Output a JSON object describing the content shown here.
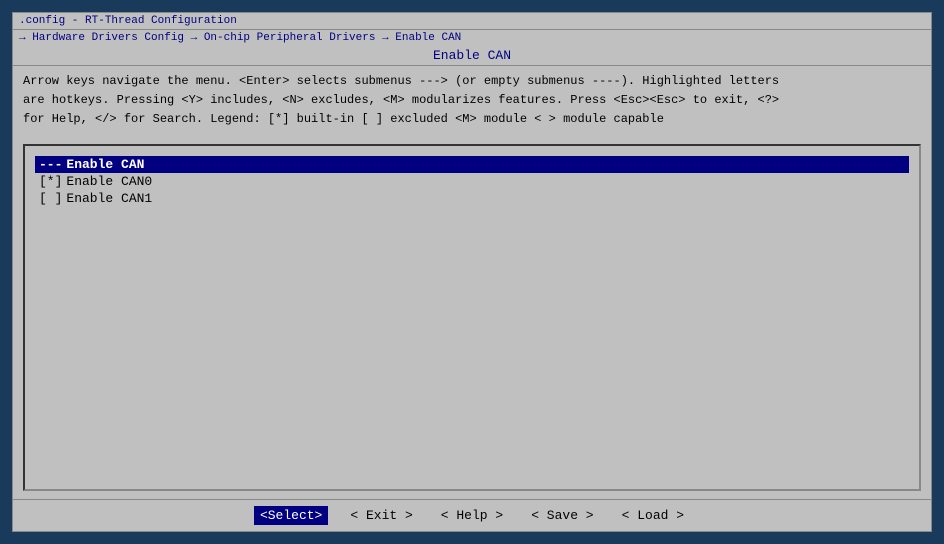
{
  "titlebar": {
    "text": ".config - RT-Thread Configuration"
  },
  "breadcrumb": {
    "text": "→ Hardware Drivers Config → On-chip Peripheral Drivers → Enable CAN"
  },
  "page_title": "Enable CAN",
  "help": {
    "line1": "Arrow keys navigate the menu.  <Enter> selects submenus ---> (or empty submenus ----).  Highlighted letters",
    "line2": "are hotkeys.  Pressing <Y> includes, <N> excludes, <M> modularizes features.  Press <Esc><Esc> to exit, <?>",
    "line3": "for Help, </> for Search.  Legend: [*] built-in  [ ] excluded  <M> module  < > module capable"
  },
  "menu": {
    "items": [
      {
        "id": "enable-can-parent",
        "prefix": "---",
        "label": "Enable CAN",
        "selected": true,
        "type": "parent"
      },
      {
        "id": "enable-can0",
        "prefix": "[*]",
        "label": "Enable CAN0",
        "selected": false,
        "type": "option"
      },
      {
        "id": "enable-can1",
        "prefix": "[ ]",
        "label": "Enable CAN1",
        "selected": false,
        "type": "option"
      }
    ]
  },
  "bottom_bar": {
    "select_label": "<Select>",
    "exit_label": "< Exit >",
    "help_label": "< Help >",
    "save_label": "< Save >",
    "load_label": "< Load >"
  }
}
